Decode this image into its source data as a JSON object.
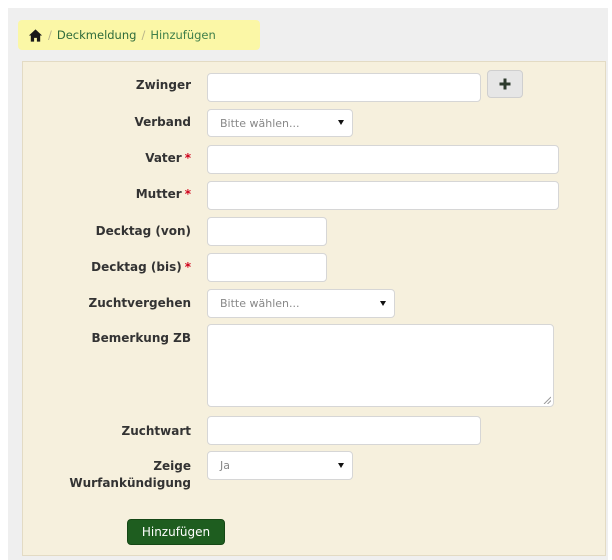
{
  "breadcrumb": {
    "items": [
      "Deckmeldung",
      "Hinzufügen"
    ],
    "separator": "/"
  },
  "form": {
    "fields": {
      "zwinger": {
        "label": "Zwinger",
        "value": "",
        "placeholder": ""
      },
      "verband": {
        "label": "Verband",
        "selected": "Bitte wählen..."
      },
      "vater": {
        "label": "Vater",
        "required_mark": "*",
        "value": ""
      },
      "mutter": {
        "label": "Mutter",
        "required_mark": "*",
        "value": ""
      },
      "decktag_von": {
        "label": "Decktag (von)",
        "value": ""
      },
      "decktag_bis": {
        "label": "Decktag (bis)",
        "required_mark": "*",
        "value": ""
      },
      "zuchtvergehen": {
        "label": "Zuchtvergehen",
        "selected": "Bitte wählen..."
      },
      "bemerkung_zb": {
        "label": "Bemerkung ZB",
        "value": ""
      },
      "zuchtwart": {
        "label": "Zuchtwart",
        "value": ""
      },
      "zeige_wurfankuendigung": {
        "label_line1": "Zeige",
        "label_line2": "Wurfankündigung",
        "selected": "Ja"
      }
    },
    "submit_label": "Hinzufügen"
  },
  "colors": {
    "breadcrumb_bg": "#fbf7a6",
    "panel_bg": "#f6f0dd",
    "submit_bg": "#1e5d1f",
    "required": "#d0021b",
    "link": "#2e6b3b"
  },
  "icons": {
    "home": "home-icon",
    "add": "plus-icon",
    "dropdown": "caret-down-icon"
  }
}
